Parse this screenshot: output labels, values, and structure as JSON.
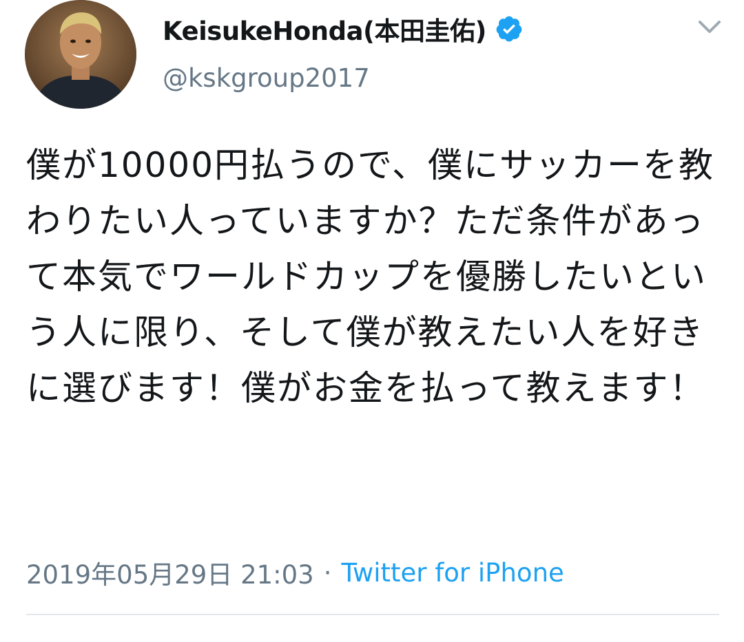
{
  "tweet": {
    "display_name": "KeisukeHonda(本田圭佑)",
    "handle": "@kskgroup2017",
    "verified": true,
    "text": "僕が10000円払うので、僕にサッカーを教わりたい人っていますか？ただ条件があって本気でワールドカップを優勝したいという人に限り、そして僕が教えたい人を好きに選びます！僕がお金を払って教えます！",
    "timestamp": "2019年05月29日 21:03",
    "separator": "·",
    "source": "Twitter for iPhone"
  },
  "icons": {
    "avatar": "profile-photo",
    "verified": "verified-badge-icon",
    "menu": "chevron-down-icon"
  },
  "colors": {
    "text": "#14171a",
    "secondary": "#657786",
    "link": "#1da1f2",
    "divider": "#e1e8ed"
  }
}
